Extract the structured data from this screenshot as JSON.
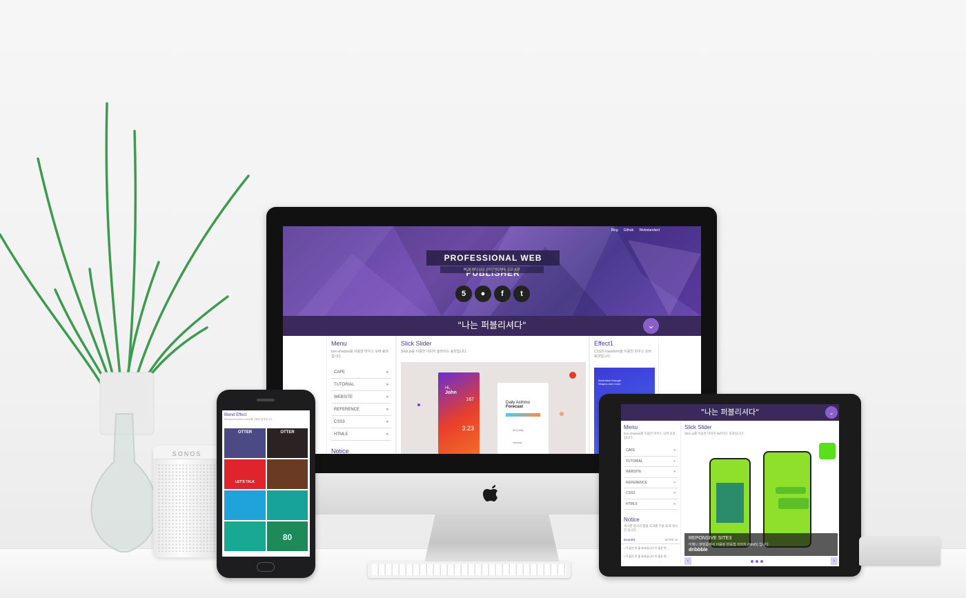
{
  "imac": {
    "topnav": [
      "Blog",
      "Github",
      "Webstandard"
    ],
    "hero_title": "PROFESSIONAL WEB PUBLISHER",
    "hero_subtitle": "MJKIM1103.DOTHOME.CO.KR",
    "social_icons": [
      "html5-icon",
      "github-icon",
      "facebook-icon",
      "twitter-icon"
    ],
    "quote": "\"나는 퍼블리셔다\"",
    "menu": {
      "title": "Menu",
      "desc": "box-shadow를 이용한 마우스 오버 효과입니다.",
      "items": [
        "CAFE",
        "TUTORIAL",
        "WEBSITE",
        "REFERENCE",
        "CSS3",
        "HTML5"
      ],
      "arrow": "»",
      "notice_partial": "Notice"
    },
    "slider": {
      "title": "Slick Slider",
      "desc": "Slick.js를 이용한 이미지 슬라이드 효과입니다.",
      "card1_greeting": "Hi,",
      "card1_name": "John",
      "card1_num": "167",
      "card1_time": "3:23",
      "card2_title1": "Daily Asthmo",
      "card2_title2": "Forecast",
      "card2_label1": "Air Quality",
      "card2_label2": "Humidity"
    },
    "effect": {
      "title": "Effect1",
      "desc": "CSS의 transform을 이용한 마우스 오버 효과입니다.",
      "thumb_text": "Illustration through Shapes and Color"
    }
  },
  "iphone": {
    "title": "Blend Effect",
    "desc": "Background-blend-mode를 이용한 효과입니다.",
    "tiles": [
      "OTTER",
      "OTTER",
      "LET'S TALK",
      "",
      "",
      "",
      "",
      "80"
    ]
  },
  "ipad": {
    "quote": "\"나는 퍼블리셔다\"",
    "menu": {
      "title": "Menu",
      "desc": "box-shadow를 이용한 마우스 오버 효과입니다.",
      "items": [
        "CAFE",
        "TUTORIAL",
        "WEBSITE",
        "REFERENCE",
        "CSS3",
        "HTML5"
      ],
      "arrow": "»"
    },
    "notice": {
      "title": "Notice",
      "desc": "게시판 형식의 탭을 효과를 두을 효과 게시한 입니다.",
      "board": "Board01",
      "more": "MORE ⊕",
      "lines": [
        "• 이 출은 한 출 효과입니다.이 출은 한...",
        "• 이 출은 한 출 효과입니다.이 출은 한..."
      ]
    },
    "slider": {
      "title": "Slick Slider",
      "desc": "Slick.js를 이용한 이미지 슬라이드 효과입니다.",
      "caption_title": "REPONSIVE SITE3",
      "caption_desc": "어메니 플랫폼에서 이용된 반응형 이미지 (html5) 입니다.",
      "watermark": "dribbble",
      "prev": "‹",
      "next": "›"
    }
  },
  "colors": {
    "brand_purple": "#3a2a5c",
    "accent_purple": "#8a5fc9",
    "heading_purple": "#4a3aa0"
  }
}
